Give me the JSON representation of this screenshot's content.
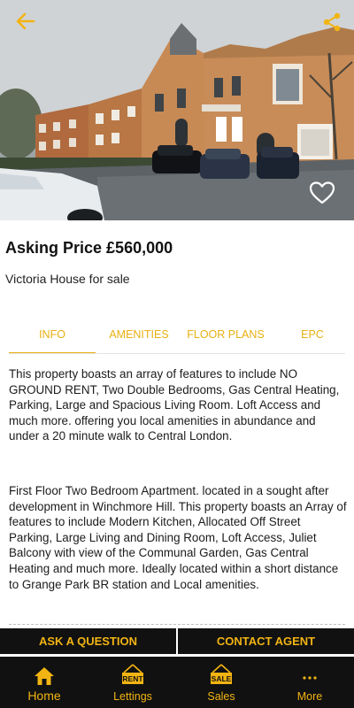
{
  "header": {
    "back_icon": "arrow-left-icon",
    "share_icon": "share-icon",
    "favorite_icon": "heart-outline-icon"
  },
  "listing": {
    "price_label": "Asking Price £560,000",
    "title": "Victoria House for sale"
  },
  "tabs": [
    {
      "label": "INFO",
      "active": true
    },
    {
      "label": "AMENITIES",
      "active": false
    },
    {
      "label": "FLOOR PLANS",
      "active": false
    },
    {
      "label": "EPC",
      "active": false
    }
  ],
  "description": {
    "paragraph1": "This property boasts an array of features to include NO GROUND RENT, Two Double Bedrooms, Gas Central Heating, Parking, Large and Spacious Living Room. Loft Access and much more. offering you local amenities in abundance and under a 20 minute walk to Central London.",
    "paragraph2": "First Floor Two Bedroom Apartment. located in a sought after development in Winchmore Hill. This property boasts an Array of features to include Modern Kitchen, Allocated Off Street Parking, Large Living and Dining Room, Loft Access, Juliet Balcony with view of the Communal Garden, Gas Central Heating and much more. Ideally located within a short distance to Grange Park BR station and Local amenities."
  },
  "actions": {
    "ask_label": "ASK A QUESTION",
    "contact_label": "CONTACT AGENT"
  },
  "bottom_nav": [
    {
      "label": "Home",
      "icon": "home-icon",
      "active": true
    },
    {
      "label": "Lettings",
      "icon": "rent-sign-icon",
      "badge": "RENT",
      "active": false
    },
    {
      "label": "Sales",
      "icon": "sale-sign-icon",
      "badge": "SALE",
      "active": false
    },
    {
      "label": "More",
      "icon": "more-dots-icon",
      "active": false
    }
  ],
  "colors": {
    "accent": "#f2b413",
    "tab_accent": "#e8b012",
    "dark": "#111111"
  }
}
